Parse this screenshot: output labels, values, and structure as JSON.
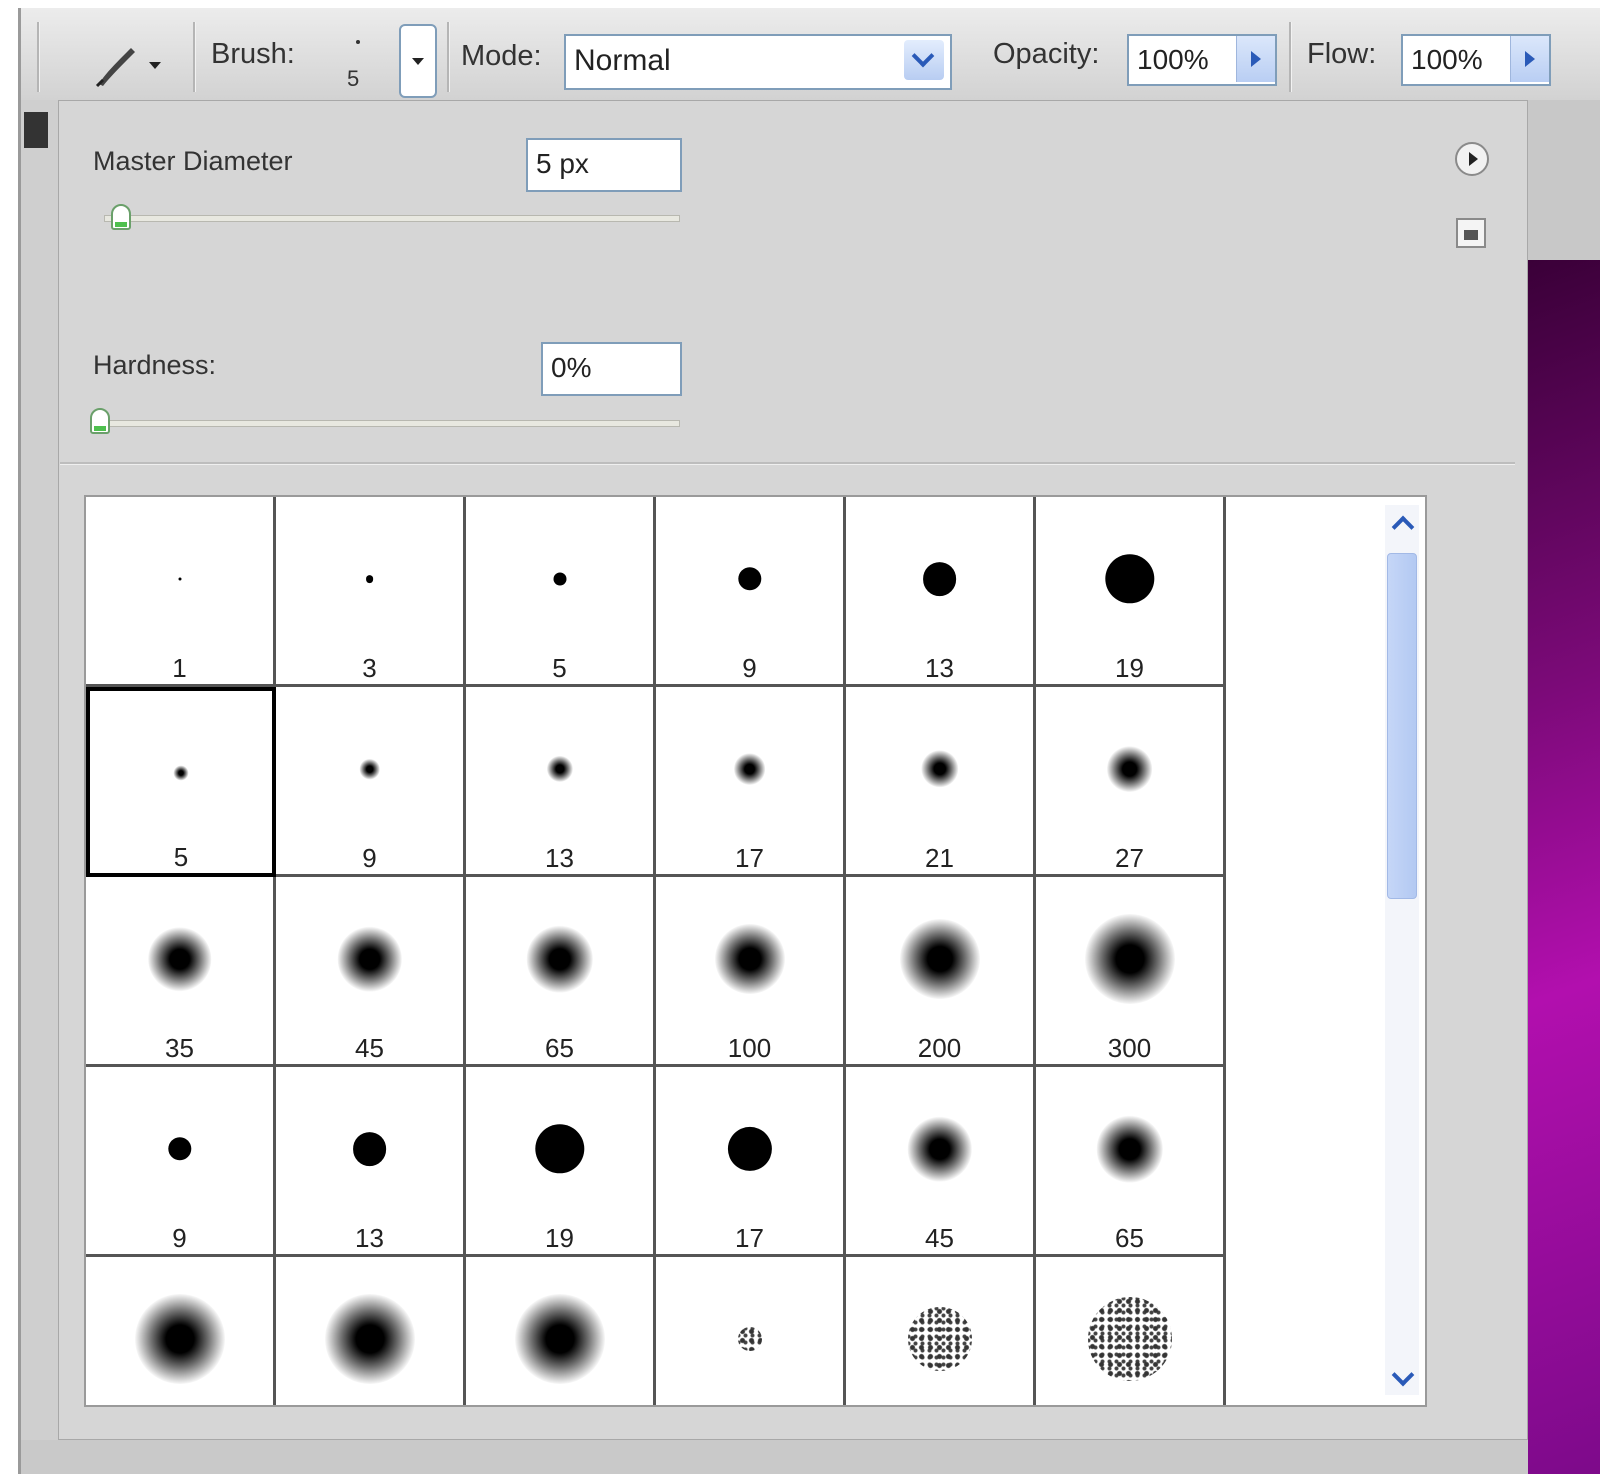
{
  "toolbar": {
    "brush_label": "Brush:",
    "brush_size": "5",
    "mode_label": "Mode:",
    "mode_value": "Normal",
    "opacity_label": "Opacity:",
    "opacity_value": "100%",
    "flow_label": "Flow:",
    "flow_value": "100%"
  },
  "panel": {
    "master_diameter_label": "Master Diameter",
    "master_diameter_value": "5 px",
    "master_diameter_level": 0.02,
    "hardness_label": "Hardness:",
    "hardness_value": "0%",
    "hardness_level": 0.0
  },
  "brushes": [
    {
      "size": "1",
      "type": "hard"
    },
    {
      "size": "3",
      "type": "hard"
    },
    {
      "size": "5",
      "type": "hard"
    },
    {
      "size": "9",
      "type": "hard"
    },
    {
      "size": "13",
      "type": "hard"
    },
    {
      "size": "19",
      "type": "hard"
    },
    {
      "size": "5",
      "type": "soft",
      "selected": true
    },
    {
      "size": "9",
      "type": "soft"
    },
    {
      "size": "13",
      "type": "soft"
    },
    {
      "size": "17",
      "type": "soft"
    },
    {
      "size": "21",
      "type": "soft"
    },
    {
      "size": "27",
      "type": "soft"
    },
    {
      "size": "35",
      "type": "soft"
    },
    {
      "size": "45",
      "type": "soft"
    },
    {
      "size": "65",
      "type": "soft"
    },
    {
      "size": "100",
      "type": "soft"
    },
    {
      "size": "200",
      "type": "soft"
    },
    {
      "size": "300",
      "type": "soft"
    },
    {
      "size": "9",
      "type": "hard"
    },
    {
      "size": "13",
      "type": "hard"
    },
    {
      "size": "19",
      "type": "hard"
    },
    {
      "size": "17",
      "type": "hard"
    },
    {
      "size": "45",
      "type": "soft"
    },
    {
      "size": "65",
      "type": "soft"
    },
    {
      "size": "",
      "type": "soft"
    },
    {
      "size": "",
      "type": "soft"
    },
    {
      "size": "",
      "type": "soft"
    },
    {
      "size": "",
      "type": "spatter"
    },
    {
      "size": "",
      "type": "spatter"
    },
    {
      "size": "",
      "type": "spatter"
    }
  ],
  "colors": {
    "panel_bg": "#d6d6d6",
    "field_border": "#7f9db9",
    "accent_blue": "#2a5ab8",
    "canvas_magenta": "#b20fae"
  }
}
